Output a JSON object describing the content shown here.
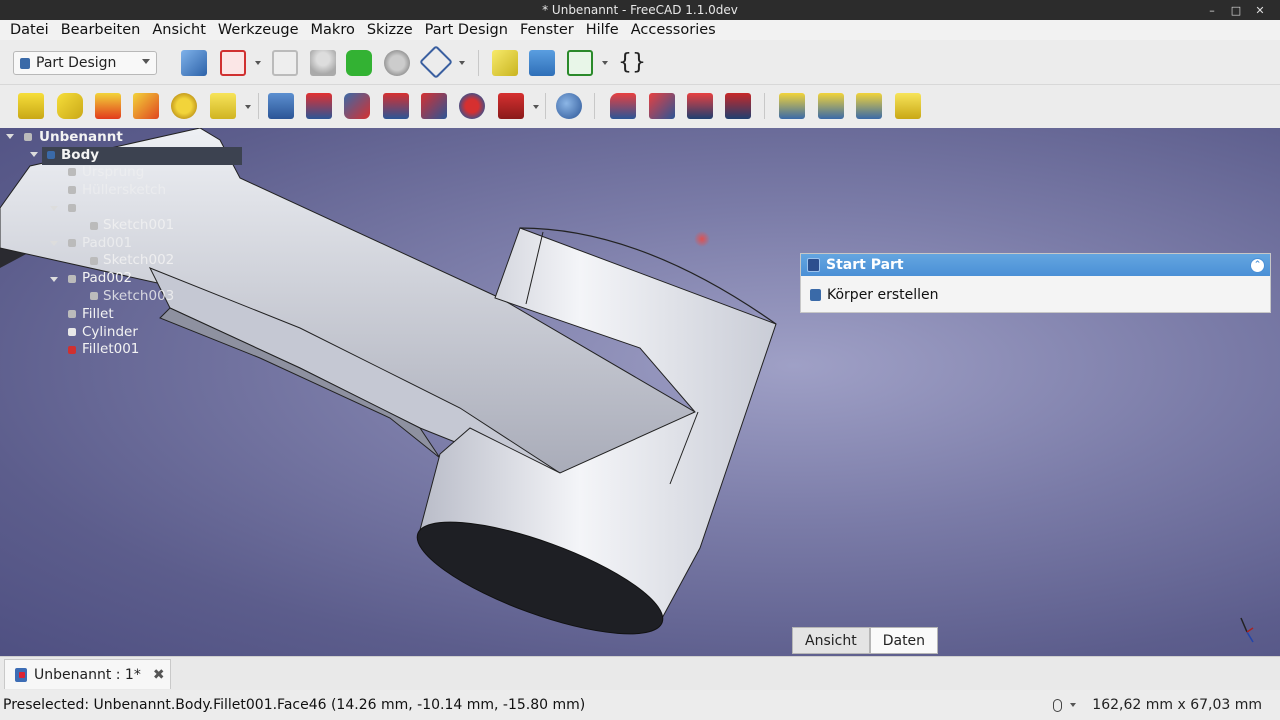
{
  "window": {
    "title": "* Unbenannt - FreeCAD 1.1.0dev"
  },
  "menu": [
    "Datei",
    "Bearbeiten",
    "Ansicht",
    "Werkzeuge",
    "Makro",
    "Skizze",
    "Part Design",
    "Fenster",
    "Hilfe",
    "Accessories"
  ],
  "toolbar": {
    "workbench": "Part Design",
    "workbench_icon": "part-design-cube-icon"
  },
  "tree": {
    "document": "Unbenannt",
    "items": [
      {
        "label": "Body",
        "level": 1,
        "selected": true
      },
      {
        "label": "Ursprung",
        "level": 2
      },
      {
        "label": "Hüllersketch",
        "level": 2
      },
      {
        "label": "",
        "level": 2
      },
      {
        "label": "Sketch001",
        "level": 3
      },
      {
        "label": "Pad001",
        "level": 2
      },
      {
        "label": "Sketch002",
        "level": 3
      },
      {
        "label": "Pad002",
        "level": 2
      },
      {
        "label": "Sketch003",
        "level": 3
      },
      {
        "label": "Fillet",
        "level": 2
      },
      {
        "label": "Cylinder",
        "level": 2
      },
      {
        "label": "Fillet001",
        "level": 2
      }
    ]
  },
  "task_panel": {
    "title": "Start Part",
    "action": "Körper erstellen"
  },
  "view_tabs": [
    "Ansicht",
    "Daten"
  ],
  "view_tabs_active": "Daten",
  "doc_tab": {
    "label": "Unbenannt : 1*"
  },
  "status": {
    "message": "Preselected: Unbenannt.Body.Fillet001.Face46 (14.26 mm, -10.14 mm, -15.80 mm)",
    "dimensions": "162,62 mm x 67,03 mm"
  }
}
